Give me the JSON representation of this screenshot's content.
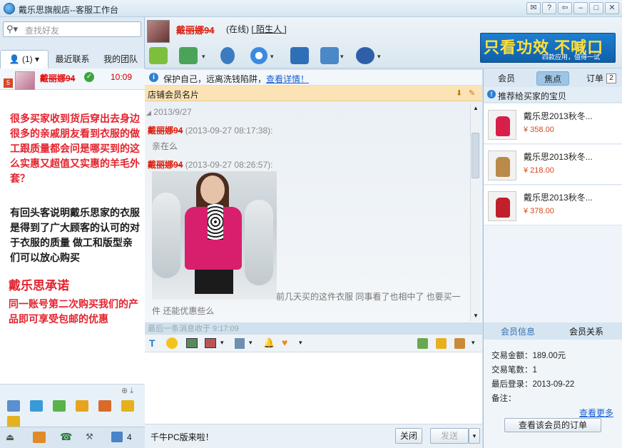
{
  "window": {
    "title": "戴乐思旗舰店--客服工作台"
  },
  "left": {
    "search_placeholder": "查找好友",
    "tabs": [
      {
        "label": "(1)"
      },
      {
        "label": "最近联系"
      },
      {
        "label": "我的团队"
      }
    ],
    "contact": {
      "badge": "5",
      "name": "戴丽娜94",
      "time": "10:09"
    },
    "ad": {
      "p1": "很多买家收到货后穿出去身边很多的亲戚朋友看到衣服的做工跟质量都会问是哪买到的这么实惠又超值又实惠的羊毛外套？",
      "p2": "有回头客说明戴乐思家的衣服是得到了广大顾客的认可的对于衣服的质量 做工和版型亲们可以放心购买",
      "p3_title": "戴乐思承诺",
      "p3": "同一账号第二次购买我们的产品即可享受包邮的优惠"
    },
    "status_count": "4"
  },
  "chat": {
    "contact_name": "戴丽娜94",
    "contact_status": "(在线)",
    "contact_tag": "[ 陌生人 ]",
    "notice_text": "保护自己，远离洗钱陷阱，",
    "notice_link": "查看详情！",
    "member_card": "店铺会员名片",
    "date": "2013/9/27",
    "msg1_sender": "戴丽娜94",
    "msg1_time": "(2013-09-27 08:17:38):",
    "msg1_text": "亲在么",
    "msg2_sender": "戴丽娜94",
    "msg2_time": "(2013-09-27 08:26:57):",
    "msg2_text": "前几天买的这件衣服 同事看了也相中了 也要买一件 还能优惠些么",
    "last_msg": "最后一条消息收于 9:17:09",
    "bottom_note": "千牛PC版来啦！",
    "close_btn": "关闭",
    "send_btn": "发送"
  },
  "banner": {
    "main": "只看功效 不喊口号",
    "sub": "四款应用，值得一试"
  },
  "right": {
    "tabs": [
      {
        "label": "会员"
      },
      {
        "label": "焦点"
      },
      {
        "label": "订单"
      }
    ],
    "order_count": "2",
    "rec_title": "推荐给买家的宝贝",
    "items": [
      {
        "name": "戴乐思2013秋冬...",
        "price": "¥ 358.00",
        "color": "#d81f4a"
      },
      {
        "name": "戴乐思2013秋冬...",
        "price": "¥ 218.00",
        "color": "#b98a4a"
      },
      {
        "name": "戴乐思2013秋冬...",
        "price": "¥ 378.00",
        "color": "#c0202a"
      }
    ],
    "member_tabs": [
      {
        "label": "会员信息"
      },
      {
        "label": "会员关系"
      }
    ],
    "member": {
      "amount": "交易金额：189.00元",
      "count": "交易笔数：1",
      "last_login": "最后登录：2013-09-22",
      "remark": "备注："
    },
    "see_more": "查看更多",
    "view_orders": "查看该会员的订单"
  }
}
